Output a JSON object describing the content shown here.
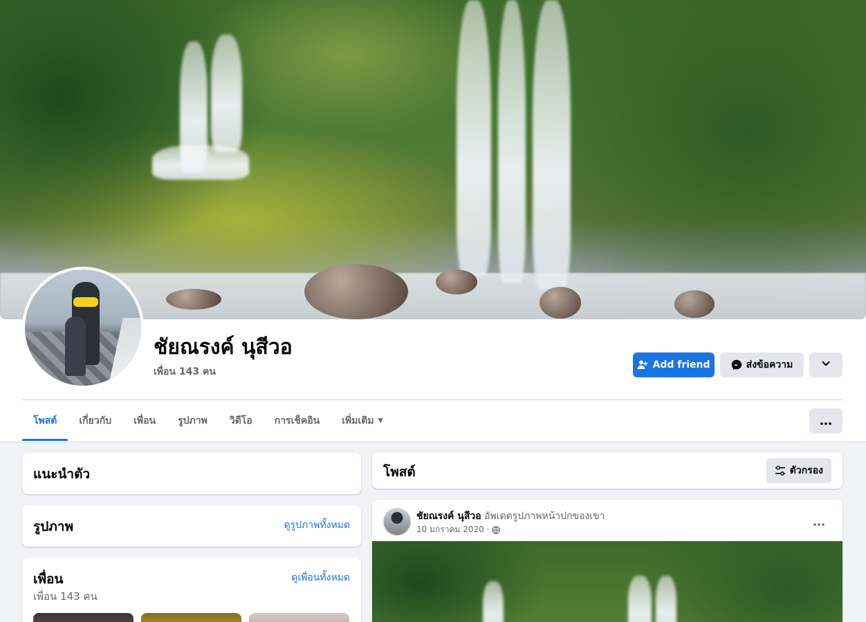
{
  "profile": {
    "name": "ชัยณรงค์ นุสีวอ",
    "friend_count": "เพื่อน 143 คน"
  },
  "actions": {
    "add_friend": "Add friend",
    "message": "ส่งข้อความ"
  },
  "tabs": [
    {
      "label": "โพสต์",
      "active": true
    },
    {
      "label": "เกี่ยวกับ"
    },
    {
      "label": "เพื่อน"
    },
    {
      "label": "รูปภาพ"
    },
    {
      "label": "วิดีโอ"
    },
    {
      "label": "การเช็คอิน"
    },
    {
      "label": "เพิ่มเติม"
    }
  ],
  "intro": {
    "title": "แนะนำตัว"
  },
  "photos": {
    "title": "รูปภาพ",
    "link": "ดูรูปภาพทั้งหมด"
  },
  "friends": {
    "title": "เพื่อน",
    "link": "ดูเพื่อนทั้งหมด",
    "count": "เพื่อน 143 คน"
  },
  "posts": {
    "title": "โพสต์",
    "filter": "ตัวกรอง"
  },
  "post": {
    "author": "ชัยณรงค์ นุสีวอ",
    "action": "อัพเดตรูปภาพหน้าปกของเขา",
    "date": "10 มกราคม 2020 ·"
  },
  "colors": {
    "accent": "#1b74e4",
    "secondary_button": "#e4e6eb",
    "page_bg": "#f0f2f5"
  },
  "icons": [
    "add-friend-icon",
    "messenger-icon",
    "chevron-down-icon",
    "more-dots-icon",
    "filter-icon",
    "globe-icon"
  ]
}
